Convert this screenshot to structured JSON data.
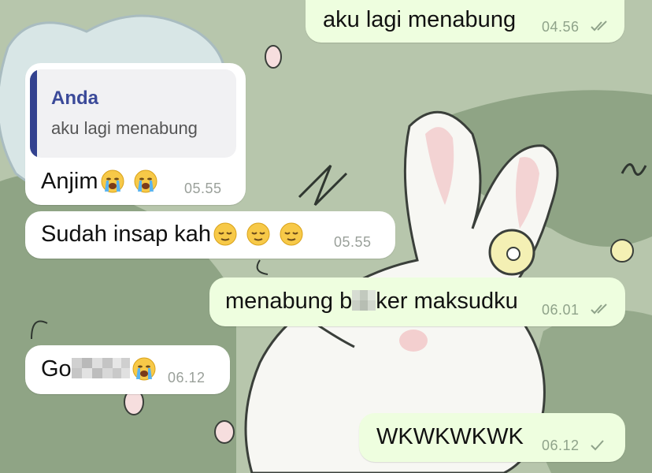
{
  "chat": {
    "colors": {
      "incoming_bubble": "#ffffff",
      "outgoing_bubble": "#eefedf",
      "reply_accent": "#33428f",
      "meta_text": "#9aa09a"
    },
    "messages": [
      {
        "direction": "outgoing",
        "text": "aku lagi menabung",
        "time": "04.56",
        "status": "read",
        "status_icon": "double-check-icon"
      },
      {
        "direction": "incoming",
        "reply": {
          "name": "Anda",
          "text": "aku lagi menabung"
        },
        "text": "Anjim",
        "emojis": [
          "loudly-crying-face",
          "loudly-crying-face"
        ],
        "time": "05.55"
      },
      {
        "direction": "incoming",
        "text": "Sudah insap kah",
        "emojis": [
          "relieved-face",
          "relieved-face",
          "relieved-face"
        ],
        "time": "05.55"
      },
      {
        "direction": "outgoing",
        "text_before": "menabung b",
        "text_after": "ker maksudku",
        "redacted": true,
        "time": "06.01",
        "status": "read",
        "status_icon": "double-check-icon"
      },
      {
        "direction": "incoming",
        "text_before": "Go",
        "redacted": true,
        "emojis": [
          "loudly-crying-face"
        ],
        "time": "06.12"
      },
      {
        "direction": "outgoing",
        "text": "WKWKWKWK",
        "time": "06.12",
        "status": "sent",
        "status_icon": "single-check-icon"
      }
    ]
  }
}
